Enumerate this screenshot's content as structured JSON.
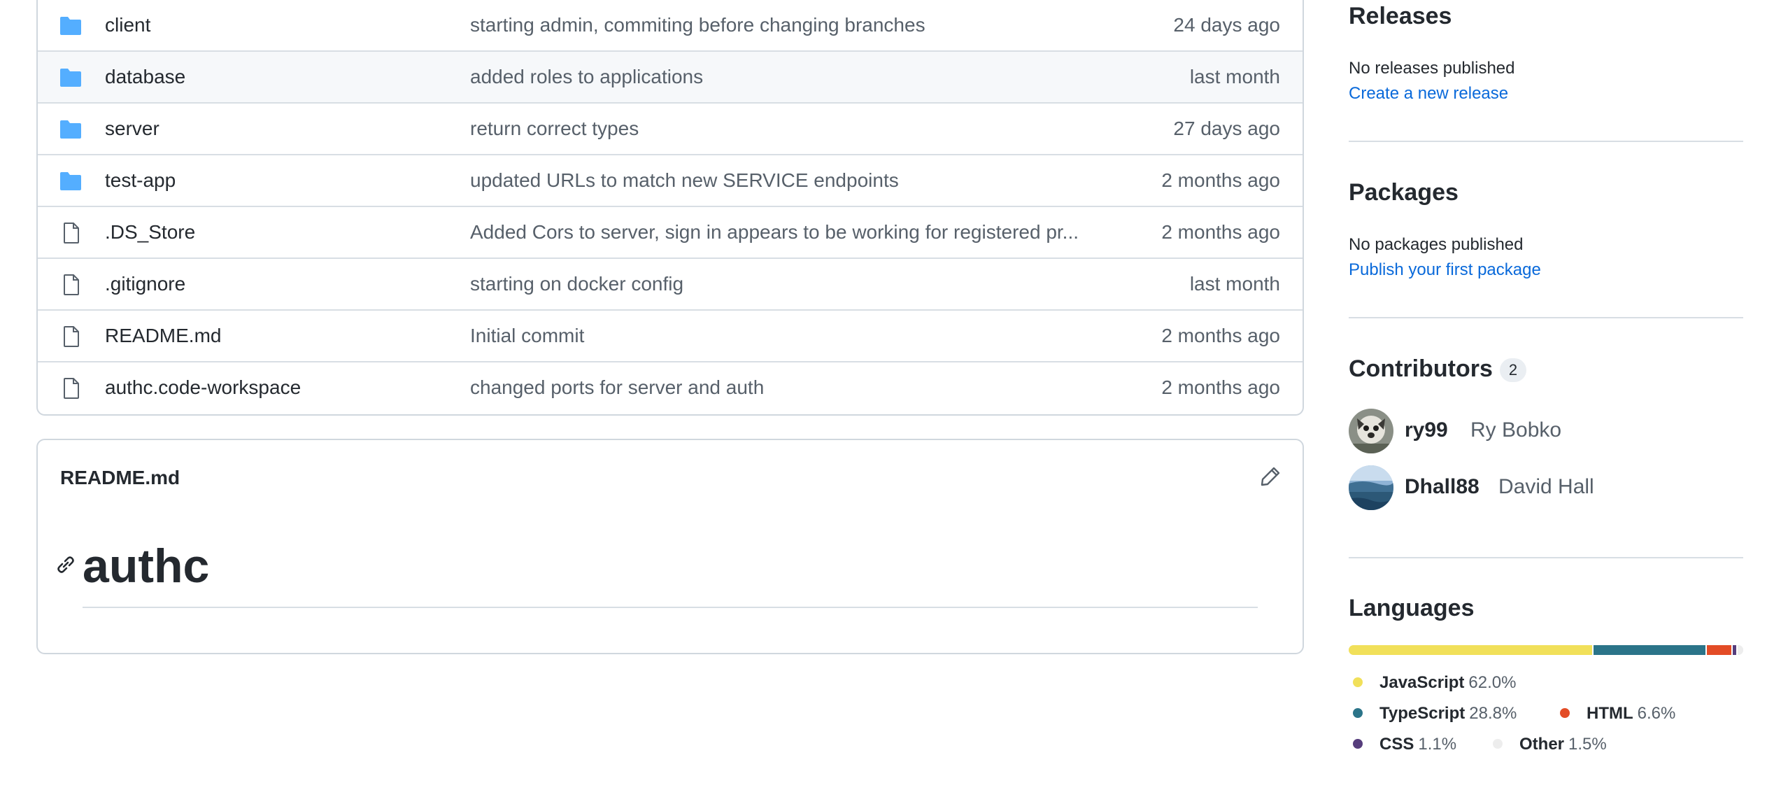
{
  "files": [
    {
      "name": "client",
      "type": "folder",
      "message": "starting admin, commiting before changing branches",
      "age": "24 days ago"
    },
    {
      "name": "database",
      "type": "folder",
      "message": "added roles to applications",
      "age": "last month"
    },
    {
      "name": "server",
      "type": "folder",
      "message": "return correct types",
      "age": "27 days ago"
    },
    {
      "name": "test-app",
      "type": "folder",
      "message": "updated URLs to match new SERVICE endpoints",
      "age": "2 months ago"
    },
    {
      "name": ".DS_Store",
      "type": "file",
      "message": "Added Cors to server, sign in appears to be working for registered pr...",
      "age": "2 months ago"
    },
    {
      "name": ".gitignore",
      "type": "file",
      "message": "starting on docker config",
      "age": "last month"
    },
    {
      "name": "README.md",
      "type": "file",
      "message": "Initial commit",
      "age": "2 months ago"
    },
    {
      "name": "authc.code-workspace",
      "type": "file",
      "message": "changed ports for server and auth",
      "age": "2 months ago"
    }
  ],
  "readme": {
    "file_title": "README.md",
    "heading": "authc"
  },
  "sidebar": {
    "releases": {
      "title": "Releases",
      "status": "No releases published",
      "link": "Create a new release"
    },
    "packages": {
      "title": "Packages",
      "status": "No packages published",
      "link": "Publish your first package"
    },
    "contributors": {
      "title": "Contributors",
      "count": "2",
      "people": [
        {
          "login": "ry99",
          "name": "Ry Bobko"
        },
        {
          "login": "Dhall88",
          "name": "David Hall"
        }
      ]
    },
    "languages": {
      "title": "Languages",
      "items": [
        {
          "name": "JavaScript",
          "pct": "62.0%",
          "value": 62.0,
          "color": "#f1e05a"
        },
        {
          "name": "TypeScript",
          "pct": "28.8%",
          "value": 28.8,
          "color": "#2b7489"
        },
        {
          "name": "HTML",
          "pct": "6.6%",
          "value": 6.6,
          "color": "#e34c26"
        },
        {
          "name": "CSS",
          "pct": "1.1%",
          "value": 1.1,
          "color": "#563d7c"
        },
        {
          "name": "Other",
          "pct": "1.5%",
          "value": 1.5,
          "color": "#ededed"
        }
      ]
    }
  },
  "colors": {
    "folder": "#54aeff",
    "link": "#0969da",
    "muted": "#57606a",
    "border": "#d0d7de"
  },
  "icons": {
    "folder": "folder-icon",
    "file": "file-icon",
    "edit": "pencil-icon",
    "anchor": "link-icon"
  }
}
